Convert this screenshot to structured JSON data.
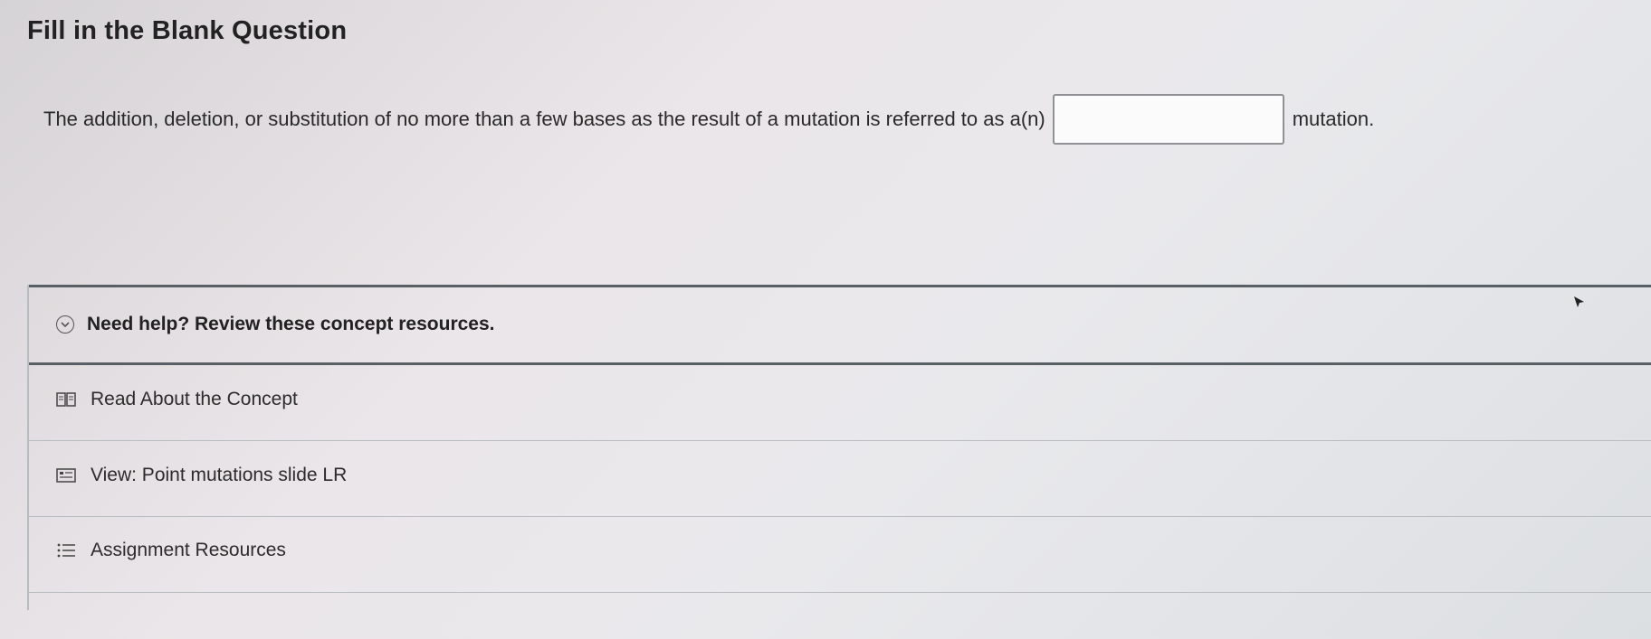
{
  "page": {
    "title": "Fill in the Blank Question"
  },
  "question": {
    "text_before": "The addition, deletion, or substitution of no more than a few bases as the result of a mutation is referred to as a(n)",
    "blank_value": "",
    "text_after": "mutation."
  },
  "help": {
    "header": "Need help? Review these concept resources.",
    "resources": [
      {
        "label": "Read About the Concept",
        "icon": "book-icon"
      },
      {
        "label": "View: Point mutations slide LR",
        "icon": "slide-icon"
      },
      {
        "label": "Assignment Resources",
        "icon": "list-icon"
      }
    ]
  },
  "colors": {
    "border_dark": "#596065",
    "border_light": "#a9adb0",
    "text": "#222222"
  }
}
